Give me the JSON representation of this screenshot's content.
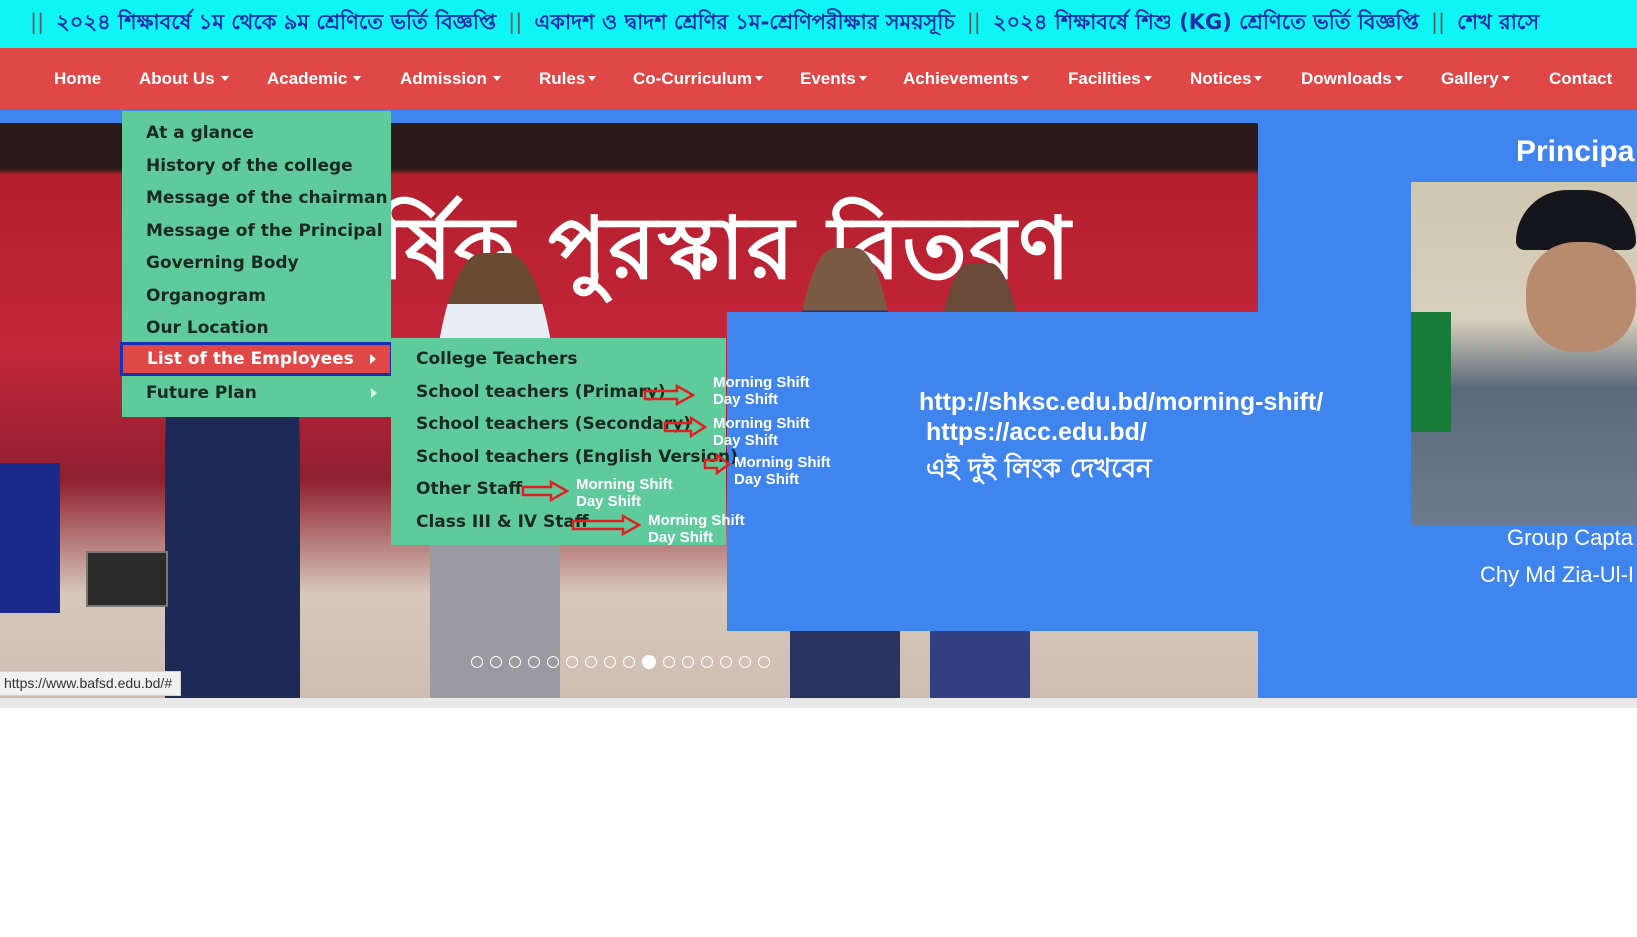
{
  "marquee": {
    "items": [
      "২০২৪ শিক্ষাবর্ষে ১ম থেকে ৯ম শ্রেণিতে ভর্তি বিজ্ঞপ্তি",
      "একাদশ ও দ্বাদশ শ্রেণির ১ম-শ্রেণিপরীক্ষার সময়সূচি",
      "২০২৪ শিক্ষাবর্ষে শিশু (KG) শ্রেণিতে ভর্তি বিজ্ঞপ্তি",
      "শেখ রাসে"
    ],
    "separator": "||"
  },
  "nav": {
    "items": [
      {
        "label": "Home"
      },
      {
        "label": "About Us"
      },
      {
        "label": "Academic"
      },
      {
        "label": "Admission"
      },
      {
        "label": "Rules"
      },
      {
        "label": "Co-Curriculum"
      },
      {
        "label": "Events"
      },
      {
        "label": "Achievements"
      },
      {
        "label": "Facilities"
      },
      {
        "label": "Notices"
      },
      {
        "label": "Downloads"
      },
      {
        "label": "Gallery"
      },
      {
        "label": "Contact"
      }
    ]
  },
  "about_menu": {
    "items": [
      {
        "label": "At a glance"
      },
      {
        "label": "History of the college"
      },
      {
        "label": "Message of the chairman"
      },
      {
        "label": "Message of the Principal"
      },
      {
        "label": "Governing Body"
      },
      {
        "label": "Organogram"
      },
      {
        "label": "Our Location"
      },
      {
        "label": "List of the Employees",
        "selected": true
      },
      {
        "label": "Future Plan"
      }
    ]
  },
  "employees_menu": {
    "items": [
      {
        "label": "College Teachers"
      },
      {
        "label": "School teachers (Primary)"
      },
      {
        "label": "School teachers (Secondary)"
      },
      {
        "label": "School teachers (English Version)"
      },
      {
        "label": "Other Staff"
      },
      {
        "label": "Class III & IV Staff"
      }
    ]
  },
  "annotations": {
    "morning": "Morning Shift",
    "day": "Day Shift",
    "arrow_color": "#e02020"
  },
  "slider": {
    "banner_text": "র্ষিক পুরস্কার বিতরণ",
    "dot_count": 16,
    "active_dot": 9
  },
  "overlay": {
    "link1": "http://shksc.edu.bd/morning-shift/",
    "link2": "https://acc.edu.bd/",
    "note": "এই দুই লিংক দেখবেন"
  },
  "principal": {
    "title": "Principa",
    "rank": "Group Capta",
    "name": "Chy Md Zia-Ul-I"
  },
  "status_bar": {
    "url": "https://www.bafsd.edu.bd/#"
  },
  "colors": {
    "marquee_bg": "#0ff5f5",
    "nav_bg": "#e04848",
    "menu_bg": "#5fcb9d",
    "hero_bg": "#4084ee",
    "selected_border": "#1a2fb0"
  }
}
